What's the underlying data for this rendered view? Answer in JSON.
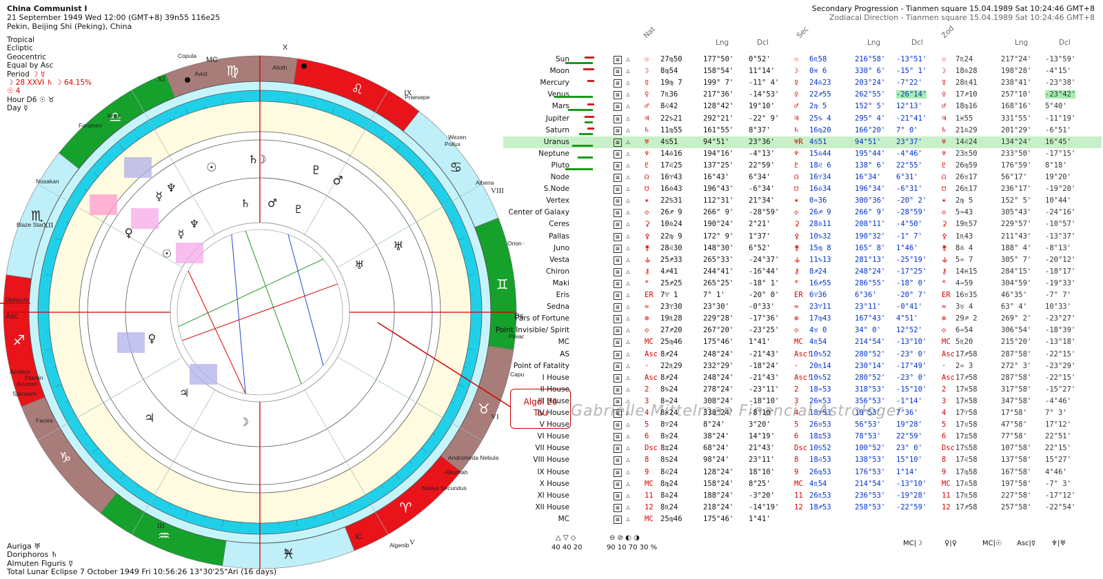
{
  "header_left": {
    "title": "China Communist I",
    "line2": "21 September 1949  Wed  12:00 (GMT+8) 39n55  116e25",
    "line3": "Pekin, Beijing Shi (Peking), China"
  },
  "header_right": {
    "line1": "Secondary Progression - Tianmen square 15.04.1989  Sat 10:24:46 GMT+8",
    "line2": "Zodiacal Direction - Tianmen square 15.04.1989  Sat 10:24:46 GMT+8"
  },
  "options": {
    "zodiac": "Tropical",
    "plane": "Ecliptic",
    "center": "Geocentric",
    "houses": "Equal by Asc",
    "period_label": "Period",
    "period_value": "☽ ☿",
    "moon_line": "☽ 28 XXVI ♄ ☽ 64.15%",
    "sun_line": "☉ 4",
    "hour_line": "Hour D6 ☉ ♉",
    "day_line": "Day ☿"
  },
  "footer_left": {
    "l1": "Auriga ♅",
    "l2": "Doriphoros ♄",
    "l3": "Almuten Figuris ☿",
    "l4": "Total Lunar Eclipse 7 October 1949 Fri 10:56:26 13°30'25\"Ari (16 days)"
  },
  "table_headers": {
    "nat": "Nat",
    "lng1": "Lng",
    "dcl1": "Dcl",
    "sec": "Sec",
    "lng2": "Lng",
    "dcl2": "Dcl",
    "zod": "Zod",
    "lng3": "Lng",
    "dcl3": "Dcl"
  },
  "rows": [
    {
      "name": "Sun",
      "g": "☉",
      "nat": "27♍50",
      "nlng": "177°50'",
      "ndcl": "0°52'",
      "s": "☉",
      "sec": "6♏58",
      "slng": "216°58'",
      "sdcl": "-13°51'",
      "z": "☉",
      "zod": "7♏24",
      "zlng": "217°24'",
      "zdcl": "-13°59'"
    },
    {
      "name": "Moon",
      "g": "☽",
      "nat": "8♍54",
      "nlng": "158°54'",
      "ndcl": "11°14'",
      "s": "☽",
      "sec": "0♓ 6",
      "slng": "330° 6'",
      "sdcl": "-15° 1'",
      "z": "☽",
      "zod": "18♎28",
      "zlng": "198°28'",
      "zdcl": "-4°15'"
    },
    {
      "name": "Mercury",
      "g": "☿",
      "nat": "19♍ 7",
      "nlng": "199° 7'",
      "ndcl": "-11° 4'",
      "s": "☿",
      "sec": "24♎23",
      "slng": "203°24'",
      "sdcl": "-7°22'",
      "z": "☿",
      "zod": "28♏41",
      "zlng": "238°41'",
      "zdcl": "-23°38'"
    },
    {
      "name": "Venus",
      "g": "♀",
      "nat": "7♏36",
      "nlng": "217°36'",
      "ndcl": "-14°53'",
      "s": "♀",
      "sec": "22♐55",
      "slng": "262°55'",
      "sdcl": "-26°14'",
      "z": "♀",
      "zod": "17♐10",
      "zlng": "257°10'",
      "zdcl": "-23°42'"
    },
    {
      "name": "Mars",
      "g": "♂",
      "nat": "8♌42",
      "nlng": "128°42'",
      "ndcl": "19°10'",
      "s": "♂",
      "sec": "2♍ 5",
      "slng": "152° 5'",
      "sdcl": "12°13'",
      "z": "♂",
      "zod": "18♍16",
      "zlng": "168°16'",
      "zdcl": "5°40'"
    },
    {
      "name": "Jupiter",
      "g": "♃",
      "nat": "22♑21",
      "nlng": "292°21'",
      "ndcl": "-22° 9'",
      "s": "♃",
      "sec": "25♑ 4",
      "slng": "295° 4'",
      "sdcl": "-21°41'",
      "z": "♃",
      "zod": "1♓55",
      "zlng": "331°55'",
      "zdcl": "-11°19'"
    },
    {
      "name": "Saturn",
      "g": "♄",
      "nat": "11♍55",
      "nlng": "161°55'",
      "ndcl": "8°37'",
      "s": "♄",
      "sec": "16♍20",
      "slng": "166°20'",
      "sdcl": "7° 0'",
      "z": "♄",
      "zod": "21♎29",
      "zlng": "201°29'",
      "zdcl": "-6°51'"
    },
    {
      "name": "Uranus",
      "g": "♅",
      "nat": "4♋51",
      "nlng": "94°51'",
      "ndcl": "23°36'",
      "s": "♅R",
      "sec": "4♋51",
      "slng": "94°51'",
      "sdcl": "23°37'",
      "z": "♅",
      "zod": "14♌24",
      "zlng": "134°24'",
      "zdcl": "16°45'"
    },
    {
      "name": "Neptune",
      "g": "♆",
      "nat": "14♎16",
      "nlng": "194°16'",
      "ndcl": "-4°13'",
      "s": "♆",
      "sec": "15♎44",
      "slng": "195°44'",
      "sdcl": "-4°46'",
      "z": "♆",
      "zod": "23♏50",
      "zlng": "233°50'",
      "zdcl": "-17°15'"
    },
    {
      "name": "Pluto",
      "g": "♇",
      "nat": "17♌25",
      "nlng": "137°25'",
      "ndcl": "22°59'",
      "s": "♇",
      "sec": "18♌ 6",
      "slng": "138° 6'",
      "sdcl": "22°55'",
      "z": "♇",
      "zod": "26♍59",
      "zlng": "176°59'",
      "zdcl": "8°18'"
    },
    {
      "name": "Node",
      "g": "☊",
      "nat": "16♈43",
      "nlng": "16°43'",
      "ndcl": "6°34'",
      "s": "☊",
      "sec": "16♈34",
      "slng": "16°34'",
      "sdcl": "6°31'",
      "z": "☊",
      "zod": "26♉17",
      "zlng": "56°17'",
      "zdcl": "19°20'"
    },
    {
      "name": "S.Node",
      "g": "☋",
      "nat": "16♎43",
      "nlng": "196°43'",
      "ndcl": "-6°34'",
      "s": "☋",
      "sec": "16♎34",
      "slng": "196°34'",
      "sdcl": "-6°31'",
      "z": "☋",
      "zod": "26♏17",
      "zlng": "236°17'",
      "zdcl": "-19°20'"
    },
    {
      "name": "Vertex",
      "g": "✶",
      "nat": "22♋31",
      "nlng": "112°31'",
      "ndcl": "21°34'",
      "s": "✶",
      "sec": "0♒36",
      "slng": "300°36'",
      "sdcl": "-20° 2'",
      "z": "✶",
      "zod": "2♍ 5",
      "zlng": "152° 5'",
      "zdcl": "10°44'"
    },
    {
      "name": "Center of Galaxy",
      "g": "◇",
      "nat": "26♐ 9",
      "nlng": "266° 9'",
      "ndcl": "-28°59'",
      "s": "◇",
      "sec": "26♐ 9",
      "slng": "266° 9'",
      "sdcl": "-28°59'",
      "z": "◇",
      "zod": "5♒43",
      "zlng": "305°43'",
      "zdcl": "-24°16'"
    },
    {
      "name": "Ceres",
      "g": "⚳",
      "nat": "10♎24",
      "nlng": "190°24'",
      "ndcl": "2°21'",
      "s": "⚳",
      "sec": "28♎11",
      "slng": "208°11'",
      "sdcl": "-4°50'",
      "z": "⚳",
      "zod": "19♏57",
      "zlng": "229°57'",
      "zdcl": "-10°57'"
    },
    {
      "name": "Pallas",
      "g": "⚴",
      "nat": "22♍ 9",
      "nlng": "172° 9'",
      "ndcl": "1°37'",
      "s": "⚴",
      "sec": "10♑32",
      "slng": "190°32'",
      "sdcl": "-1° 7'",
      "z": "⚴",
      "zod": "1♏43",
      "zlng": "211°43'",
      "zdcl": "-13°37'"
    },
    {
      "name": "Juno",
      "g": "⚵",
      "nat": "28♌30",
      "nlng": "148°30'",
      "ndcl": "6°52'",
      "s": "⚵",
      "sec": "15♍ 8",
      "slng": "165° 8'",
      "sdcl": "1°46'",
      "z": "⚵",
      "zod": "8♎ 4",
      "zlng": "188° 4'",
      "zdcl": "-8°13'"
    },
    {
      "name": "Vesta",
      "g": "⚶",
      "nat": "25♐33",
      "nlng": "265°33'",
      "ndcl": "-24°37'",
      "s": "⚶",
      "sec": "11♑13",
      "slng": "281°13'",
      "sdcl": "-25°19'",
      "z": "⚶",
      "zod": "5♒ 7",
      "zlng": "305° 7'",
      "zdcl": "-20°12'"
    },
    {
      "name": "Chiron",
      "g": "⚷",
      "nat": "4♐41",
      "nlng": "244°41'",
      "ndcl": "-16°44'",
      "s": "⚷",
      "sec": "8♐24",
      "slng": "248°24'",
      "sdcl": "-17°25'",
      "z": "⚷",
      "zod": "14♓15",
      "zlng": "284°15'",
      "zdcl": "-18°17'"
    },
    {
      "name": "Maki",
      "g": "*",
      "nat": "25♐25",
      "nlng": "265°25'",
      "ndcl": "-18° 1'",
      "s": "*",
      "sec": "16♐55",
      "slng": "286°55'",
      "sdcl": "-18° 0'",
      "z": "*",
      "zod": "4♒59",
      "zlng": "304°59'",
      "zdcl": "-19°33'"
    },
    {
      "name": "Eris",
      "g": "ER",
      "nat": "7♈ 1",
      "nlng": "7° 1'",
      "ndcl": "-20° 0'",
      "s": "ER",
      "sec": "6♈36",
      "slng": "6°36'",
      "sdcl": "-20° 7'",
      "z": "ER",
      "zod": "16♉35",
      "zlng": "46°35'",
      "zdcl": "-7° 7'"
    },
    {
      "name": "Sedna",
      "g": "≈",
      "nat": "23♈30",
      "nlng": "23°30'",
      "ndcl": "-0°33'",
      "s": "≈",
      "sec": "23♈11",
      "slng": "23°11'",
      "sdcl": "-0°41'",
      "z": "≈",
      "zod": "3♉ 4",
      "zlng": "63° 4'",
      "zdcl": "10°33'"
    },
    {
      "name": "Pars of Fortune",
      "g": "⊗",
      "nat": "19♏28",
      "nlng": "229°28'",
      "ndcl": "-17°36'",
      "s": "⊗",
      "sec": "17♍43",
      "slng": "167°43'",
      "sdcl": "4°51'",
      "z": "⊗",
      "zod": "29♐ 2",
      "zlng": "269° 2'",
      "zdcl": "-23°27'"
    },
    {
      "name": "Point Invisible/ Spirit",
      "g": "◇",
      "nat": "27♐20",
      "nlng": "267°20'",
      "ndcl": "-23°25'",
      "s": "◇",
      "sec": "4♉ 0",
      "slng": "34° 0'",
      "sdcl": "12°52'",
      "z": "◇",
      "zod": "6♒54",
      "zlng": "306°54'",
      "zdcl": "-18°39'"
    },
    {
      "name": "MC",
      "g": "MC",
      "nat": "25♍46",
      "nlng": "175°46'",
      "ndcl": "1°41'",
      "s": "MC",
      "sec": "4♏54",
      "slng": "214°54'",
      "sdcl": "-13°10'",
      "z": "MC",
      "zod": "5♏20",
      "zlng": "215°20'",
      "zdcl": "-13°18'"
    },
    {
      "name": "AS",
      "g": "Asc",
      "nat": "8♐24",
      "nlng": "248°24'",
      "ndcl": "-21°43'",
      "s": "Asc!",
      "sec": "10♑52",
      "slng": "280°52'",
      "sdcl": "-23° 0'",
      "z": "Asc",
      "zod": "17♐58",
      "zlng": "287°58'",
      "zdcl": "-22°15'"
    },
    {
      "name": "Point of Fatality",
      "g": "·",
      "nat": "22♏29",
      "nlng": "232°29'",
      "ndcl": "-18°24'",
      "s": "·",
      "sec": "20♏14",
      "slng": "230°14'",
      "sdcl": "-17°49'",
      "z": "·",
      "zod": "2♒ 3",
      "zlng": "272° 3'",
      "zdcl": "-23°29'"
    },
    {
      "name": "I House",
      "g": "Asc",
      "nat": "8♐24",
      "nlng": "248°24'",
      "ndcl": "-21°43'",
      "s": "Asc!",
      "sec": "10♑52",
      "slng": "280°52'",
      "sdcl": "-23° 0'",
      "z": "Asc",
      "zod": "17♐58",
      "zlng": "287°58'",
      "zdcl": "-22°15'"
    },
    {
      "name": "II House",
      "g": "2",
      "nat": "8♑24",
      "nlng": "278°24'",
      "ndcl": "-23°11'",
      "s": "2",
      "sec": "18♒53",
      "slng": "318°53'",
      "sdcl": "-15°10'",
      "z": "2",
      "zod": "17♓58",
      "zlng": "317°58'",
      "zdcl": "-15°27'"
    },
    {
      "name": "III House",
      "g": "3",
      "nat": "8♒24",
      "nlng": "308°24'",
      "ndcl": "-18°10'",
      "s": "3",
      "sec": "26♓53",
      "slng": "356°53'",
      "sdcl": "-1°14'",
      "z": "3",
      "zod": "17♓58",
      "zlng": "347°58'",
      "zdcl": "-4°46'"
    },
    {
      "name": "IV House",
      "g": "4",
      "nat": "8♓24",
      "nlng": "338°24'",
      "ndcl": "-8°10'",
      "s": "4",
      "sec": "18♈53",
      "slng": "18°53'",
      "sdcl": "7°36'",
      "z": "4",
      "zod": "17♈58",
      "zlng": "17°58'",
      "zdcl": "7° 3'"
    },
    {
      "name": "V House",
      "g": "5",
      "nat": "8♈24",
      "nlng": "8°24'",
      "ndcl": "3°20'",
      "s": "5",
      "sec": "26♉53",
      "slng": "56°53'",
      "sdcl": "19°28'",
      "z": "5",
      "zod": "17♉58",
      "zlng": "47°58'",
      "zdcl": "17°12'"
    },
    {
      "name": "VI House",
      "g": "6",
      "nat": "8♉24",
      "nlng": "38°24'",
      "ndcl": "14°19'",
      "s": "6",
      "sec": "18♊53",
      "slng": "78°53'",
      "sdcl": "22°59'",
      "z": "6",
      "zod": "17♊58",
      "zlng": "77°58'",
      "zdcl": "22°51'"
    },
    {
      "name": "VII House",
      "g": "Dsc",
      "nat": "8♊24",
      "nlng": "68°24'",
      "ndcl": "21°43'",
      "s": "Dsc",
      "sec": "10♋52",
      "slng": "100°52'",
      "sdcl": "23° 0'",
      "z": "Dsc",
      "zod": "17♋58",
      "zlng": "107°58'",
      "zdcl": "22°15'"
    },
    {
      "name": "VIII House",
      "g": "8",
      "nat": "8♋24",
      "nlng": "98°24'",
      "ndcl": "23°11'",
      "s": "8",
      "sec": "18♌53",
      "slng": "138°53'",
      "sdcl": "15°10'",
      "z": "8",
      "zod": "17♌58",
      "zlng": "137°58'",
      "zdcl": "15°27'"
    },
    {
      "name": "IX House",
      "g": "9",
      "nat": "8♌24",
      "nlng": "128°24'",
      "ndcl": "18°10'",
      "s": "9",
      "sec": "26♍53",
      "slng": "176°53'",
      "sdcl": "1°14'",
      "z": "9",
      "zod": "17♍58",
      "zlng": "167°58'",
      "zdcl": "4°46'"
    },
    {
      "name": "X House",
      "g": "MC",
      "nat": "8♍24",
      "nlng": "158°24'",
      "ndcl": "8°25'",
      "s": "MC",
      "sec": "4♏54",
      "slng": "214°54'",
      "sdcl": "-13°10'",
      "z": "MC",
      "zod": "17♎58",
      "zlng": "197°58'",
      "zdcl": "-7° 3'"
    },
    {
      "name": "XI House",
      "g": "11",
      "nat": "8♎24",
      "nlng": "188°24'",
      "ndcl": "-3°20'",
      "s": "11",
      "sec": "26♏53",
      "slng": "236°53'",
      "sdcl": "-19°28'",
      "z": "11",
      "zod": "17♏58",
      "zlng": "227°58'",
      "zdcl": "-17°12'"
    },
    {
      "name": "XII House",
      "g": "12",
      "nat": "8♏24",
      "nlng": "218°24'",
      "ndcl": "-14°19'",
      "s": "12",
      "sec": "18♐53",
      "slng": "258°53'",
      "sdcl": "-22°59'",
      "z": "12",
      "zod": "17♐58",
      "zlng": "257°58'",
      "zdcl": "-22°54'"
    },
    {
      "name": "MC",
      "g": "MC",
      "nat": "25♍46",
      "nlng": "175°46'",
      "ndcl": "1°41'",
      "s": "",
      "sec": "",
      "slng": "",
      "sdcl": "",
      "z": "",
      "zod": "",
      "zlng": "",
      "zdcl": ""
    }
  ],
  "callout": {
    "line1": "Algol 26",
    "line2": "Tau"
  },
  "watermark": "Gabrielle Mittelman Financial Astrologer",
  "legend_bottom": {
    "a": "40  40  20",
    "b": "90  10  70  30 %"
  },
  "bottom_right": {
    "a": "MC|☽",
    "b": "♀|♀",
    "c": "MC|☉",
    "d": "Asc|☿",
    "e": "♆|♅"
  },
  "wheel": {
    "houses": [
      "I",
      "II",
      "III",
      "IV",
      "V",
      "VI",
      "VII",
      "VIII",
      "IX",
      "X",
      "XI",
      "XII"
    ],
    "axis_labels": {
      "asc": "Asc",
      "dsc": "Dsc",
      "mc": "MC",
      "ic": "IC",
      "x": "X"
    },
    "stars": [
      "Copula",
      "Alioth",
      "Praesepe",
      "Wezen",
      "Pollux",
      "Alhena",
      "Orion Nebula",
      "Pleiades",
      "Capulus",
      "Andromeda Nebula",
      "Alkurhah",
      "Nodus Secundus",
      "Algenib",
      "Facies",
      "Spiculum",
      "Aculeus",
      "Etamin",
      "Acumen",
      "Blaze Star",
      "Nusakan",
      "Foramen",
      "Kraz",
      "Aviot",
      "Ophiuchi"
    ],
    "color_ring": "#20d0e8",
    "color_inner": "#fffbe0",
    "color_outer": "#c8f4fb"
  }
}
